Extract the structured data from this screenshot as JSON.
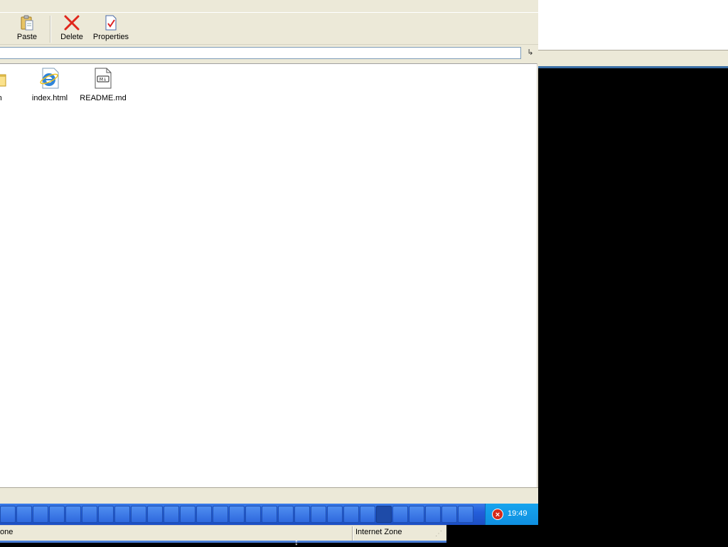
{
  "toolbar": {
    "buttons": [
      {
        "label": "Paste",
        "icon": "paste-icon"
      },
      {
        "label": "Delete",
        "icon": "delete-icon"
      },
      {
        "label": "Properties",
        "icon": "properties-icon"
      }
    ]
  },
  "address_bar": {
    "value": "",
    "go_icon": "go-arrow-icon"
  },
  "files": [
    {
      "name": "em",
      "icon": "folder-icon"
    },
    {
      "name": "index.html",
      "icon": "internet-explorer-html-icon"
    },
    {
      "name": "README.md",
      "icon": "markdown-file-icon"
    }
  ],
  "taskbar": {
    "tray_icon": "error-x-icon",
    "clock": "19:49"
  },
  "statusbar": {
    "left_text": "one",
    "zone": "Internet Zone"
  },
  "colors": {
    "taskbar_blue": "#245edb",
    "tray_blue": "#0f8fe0",
    "chrome_beige": "#ece9d8",
    "delete_red": "#e0271c"
  }
}
